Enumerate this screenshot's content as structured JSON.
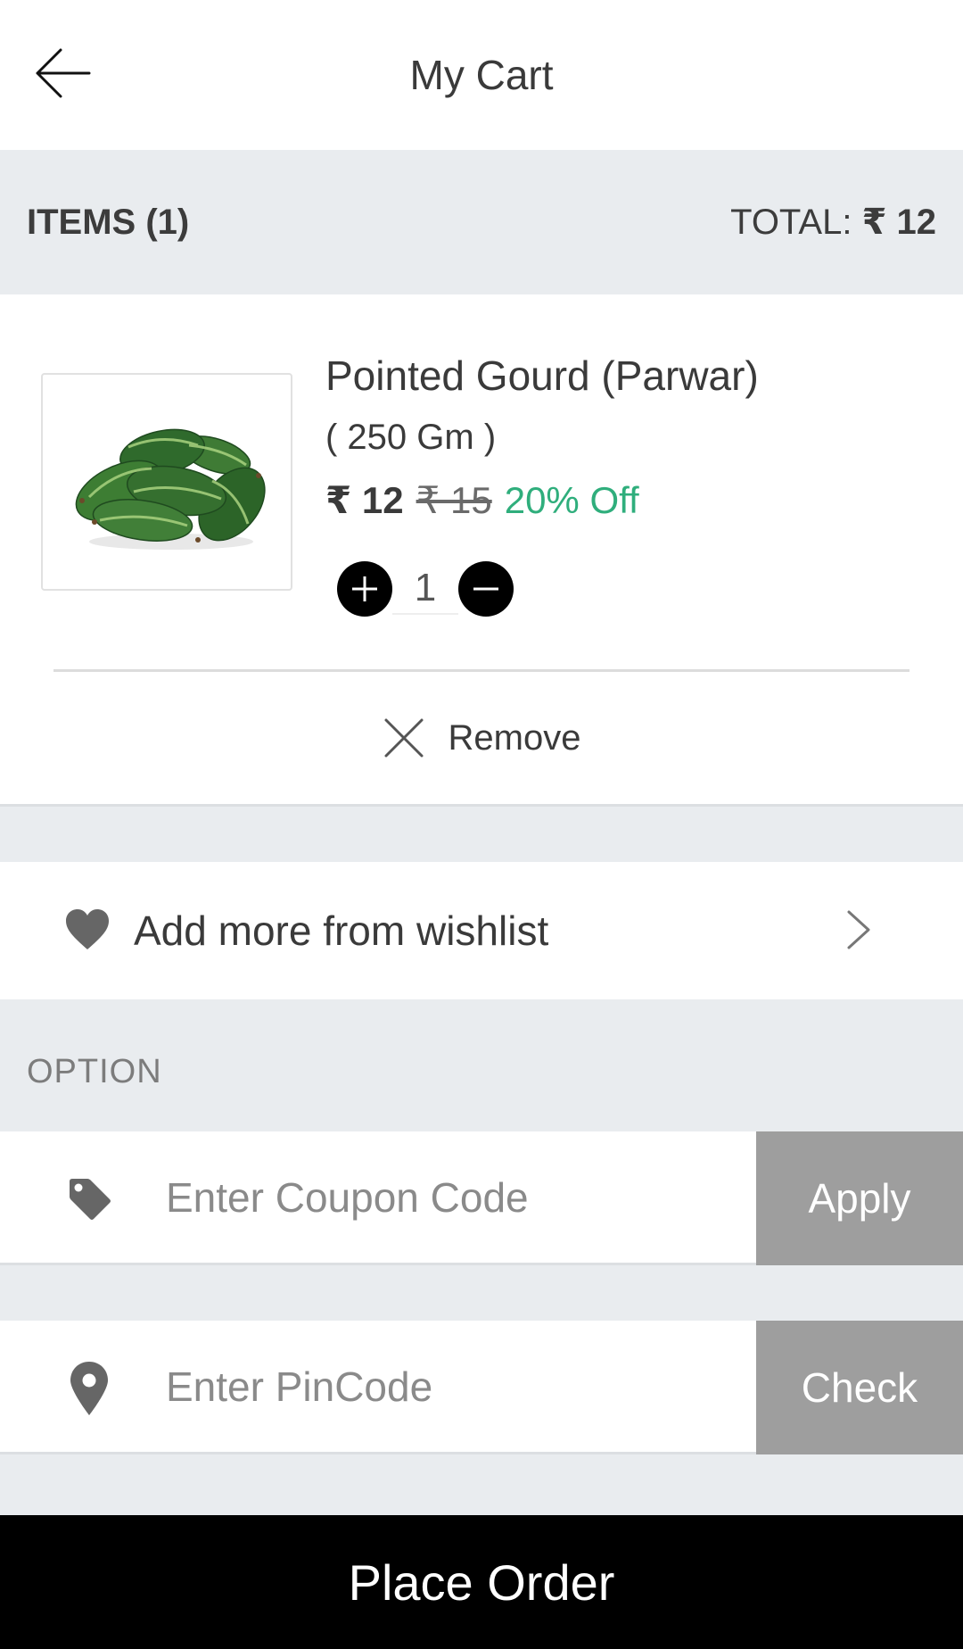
{
  "header": {
    "back_icon": "arrow-left-icon",
    "title": "My Cart"
  },
  "summary": {
    "items_label": "ITEMS (1)",
    "total_prefix": "TOTAL:",
    "total_value": "₹ 12"
  },
  "cart": {
    "items": [
      {
        "name": "Pointed Gourd (Parwar)",
        "unit": "( 250 Gm )",
        "price": "₹ 12",
        "original_price": "₹ 15",
        "discount": "20% Off",
        "quantity": "1",
        "increment_icon": "plus-circle-icon",
        "decrement_icon": "minus-circle-icon",
        "remove_icon": "close-icon",
        "remove_label": "Remove"
      }
    ]
  },
  "wishlist": {
    "icon": "heart-icon",
    "label": "Add more from wishlist",
    "chevron_icon": "chevron-right-icon"
  },
  "options": {
    "header": "OPTION",
    "coupon": {
      "icon": "tag-icon",
      "placeholder": "Enter Coupon Code",
      "value": "",
      "action_label": "Apply"
    },
    "pincode": {
      "icon": "location-pin-icon",
      "placeholder": "Enter PinCode",
      "value": "",
      "action_label": "Check"
    }
  },
  "footer": {
    "place_order_label": "Place Order"
  },
  "colors": {
    "discount_green": "#2fae7c",
    "action_grey": "#9e9e9e",
    "page_background": "#e9ecef",
    "footer_black": "#000000"
  }
}
